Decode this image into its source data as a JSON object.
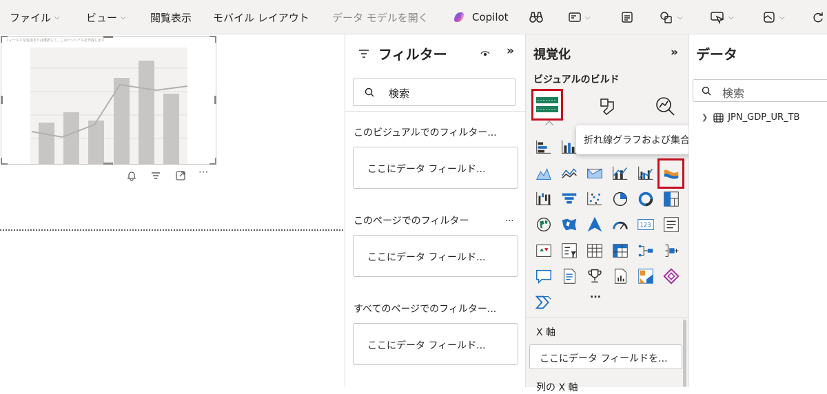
{
  "ribbon": {
    "file_label": "ファイル",
    "view_label": "ビュー",
    "reading_view_label": "閲覧表示",
    "mobile_layout_label": "モバイル レイアウト",
    "open_data_model_label": "データ モデルを開く",
    "copilot_label": "Copilot"
  },
  "canvas": {
    "visual_message": "フィールドを追加または選択して、このビジュアルを作成します"
  },
  "filters": {
    "title": "フィルター",
    "search_placeholder": "検索",
    "on_visual_label": "このビジュアルでのフィルター...",
    "on_page_label": "このページでのフィルター",
    "on_all_pages_label": "すべてのページでのフィルター...",
    "more_label": "...",
    "drop_label": "ここにデータ フィールド..."
  },
  "visualizations": {
    "title": "視覚化",
    "build_label": "ビジュアルのビルド",
    "tooltip": "折れ線グラフおよび集合縦棒グラフ",
    "x_axis_label": "X 軸",
    "x_axis_drop": "ここにデータ フィールドを...",
    "column_x_axis_label": "列の X 軸",
    "more_visuals_label": "..."
  },
  "data": {
    "title": "データ",
    "search_placeholder": "検索",
    "table_name": "JPN_GDP_UR_TB"
  },
  "colors": {
    "accent": "#c50f1f",
    "viz_blue": "#1f6fc5",
    "panel_bg": "#f3f2f1"
  }
}
